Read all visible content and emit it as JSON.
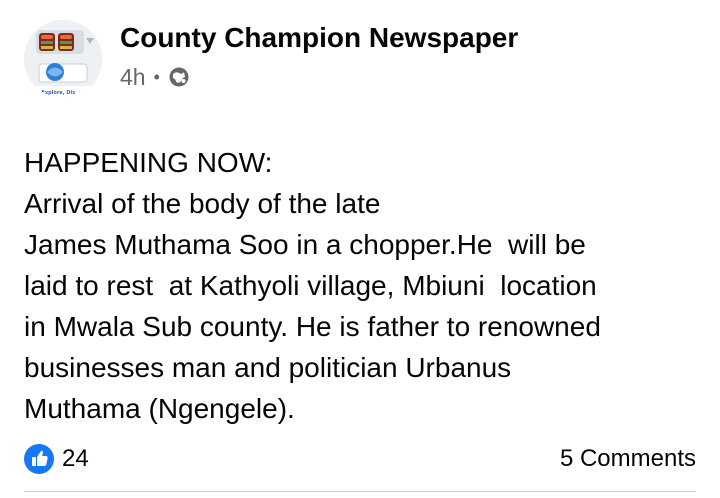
{
  "post": {
    "page_name": "County Champion Newspaper",
    "timestamp": "4h",
    "separator": "•",
    "privacy_icon": "globe-icon",
    "avatar_text": "h,Explore, Dis",
    "text_lines": [
      "HAPPENING NOW:",
      "Arrival of the body of the late",
      "James Muthama Soo in a chopper.He  will be",
      "laid to rest  at Kathyoli village, Mbiuni  location",
      "in Mwala Sub county. He is father to renowned",
      "businesses man and politician Urbanus",
      "Muthama (Ngengele)."
    ]
  },
  "footer": {
    "reaction_icon": "like-icon",
    "reaction_count": "24",
    "comments_label": "5 Comments"
  },
  "colors": {
    "text": "#050505",
    "secondary_text": "#65676b",
    "like_blue": "#1877f2",
    "divider": "#ced0d4"
  }
}
